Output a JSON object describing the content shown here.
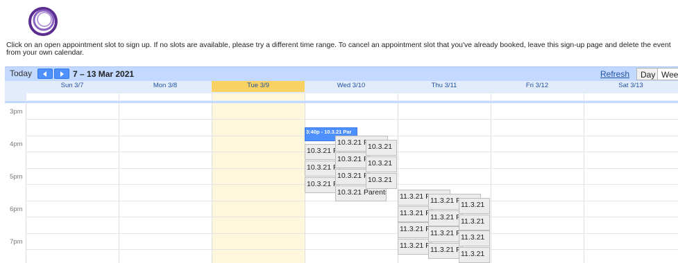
{
  "instructions": "Click on an open appointment slot to sign up. If no slots are available, please try a different time range. To cancel an appointment slot that you've already booked, leave this sign-up page and delete the event from your own calendar.",
  "toolbar": {
    "today_label": "Today",
    "prev_icon": "chevron-left-icon",
    "next_icon": "chevron-right-icon",
    "date_range": "7 – 13 Mar 2021",
    "refresh_label": "Refresh",
    "day_label": "Day",
    "week_label": "Week"
  },
  "days": [
    {
      "label": "Sun 3/7"
    },
    {
      "label": "Mon 3/8"
    },
    {
      "label": "Tue 3/9",
      "today": true
    },
    {
      "label": "Wed 3/10"
    },
    {
      "label": "Thu 3/11"
    },
    {
      "label": "Fri 3/12"
    },
    {
      "label": "Sat 3/13"
    }
  ],
  "hours": [
    "3pm",
    "4pm",
    "5pm",
    "6pm",
    "7pm"
  ],
  "events": {
    "booked": "3:40p - 10.3.21 Par",
    "wed_slots": [
      "10.3.21 P",
      "10.3.21 P",
      "10.3.21 P",
      "10.3.21 P",
      "10.3.21 P",
      "10.3.21 P",
      "10.3.21 Parents'",
      "10.3.21",
      "10.3.21",
      "10.3.21"
    ],
    "thu_slots": [
      "11.3.21 P",
      "11.3.21 P",
      "11.3.21 P",
      "11.3.21 P",
      "11.3.21 P",
      "11.3.21 P",
      "11.3.21 P",
      "11.3.21 P",
      "11.3.21",
      "11.3.21",
      "11.3.21",
      "11.3.21"
    ]
  },
  "colors": {
    "toolbar_bg": "#c3d9ff",
    "today_header": "#fad163",
    "today_column": "#fff7dc",
    "booked_event": "#4d90fe",
    "logo": "#6b3fa0"
  }
}
